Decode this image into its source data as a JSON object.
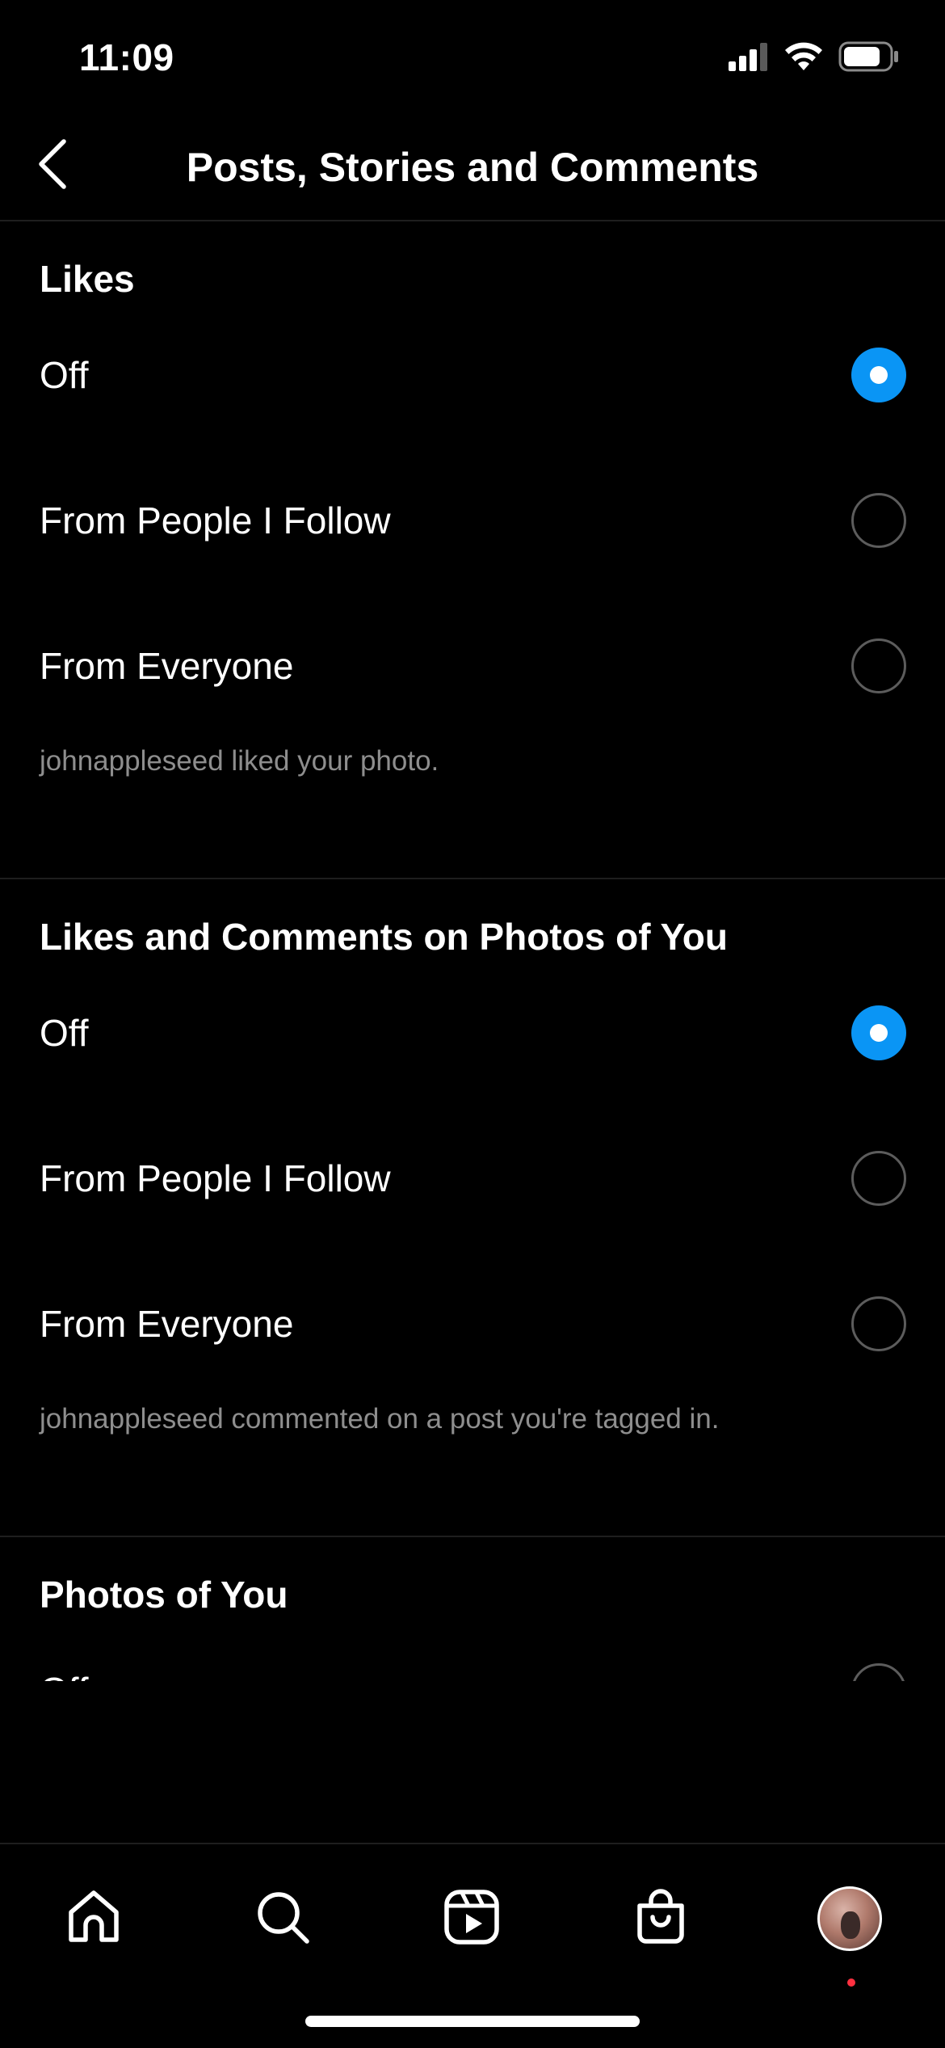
{
  "status_bar": {
    "time": "11:09"
  },
  "header": {
    "title": "Posts, Stories and Comments"
  },
  "sections": [
    {
      "heading": "Likes",
      "options": [
        {
          "label": "Off",
          "selected": true
        },
        {
          "label": "From People I Follow",
          "selected": false
        },
        {
          "label": "From Everyone",
          "selected": false
        }
      ],
      "caption": "johnappleseed liked your photo."
    },
    {
      "heading": "Likes and Comments on Photos of You",
      "options": [
        {
          "label": "Off",
          "selected": true
        },
        {
          "label": "From People I Follow",
          "selected": false
        },
        {
          "label": "From Everyone",
          "selected": false
        }
      ],
      "caption": "johnappleseed commented on a post you're tagged in."
    },
    {
      "heading": "Photos of You",
      "options": [
        {
          "label": "Off",
          "selected": false
        }
      ]
    }
  ],
  "bottom_nav": {
    "items": [
      {
        "icon": "home-icon"
      },
      {
        "icon": "search-icon"
      },
      {
        "icon": "reels-icon"
      },
      {
        "icon": "shop-icon"
      },
      {
        "icon": "profile-avatar"
      }
    ],
    "has_notification": true
  },
  "colors": {
    "background": "#000000",
    "accent": "#0A95F5",
    "caption": "#8E8E8E",
    "divider": "#1E1E1E",
    "notification": "#FF3040"
  }
}
